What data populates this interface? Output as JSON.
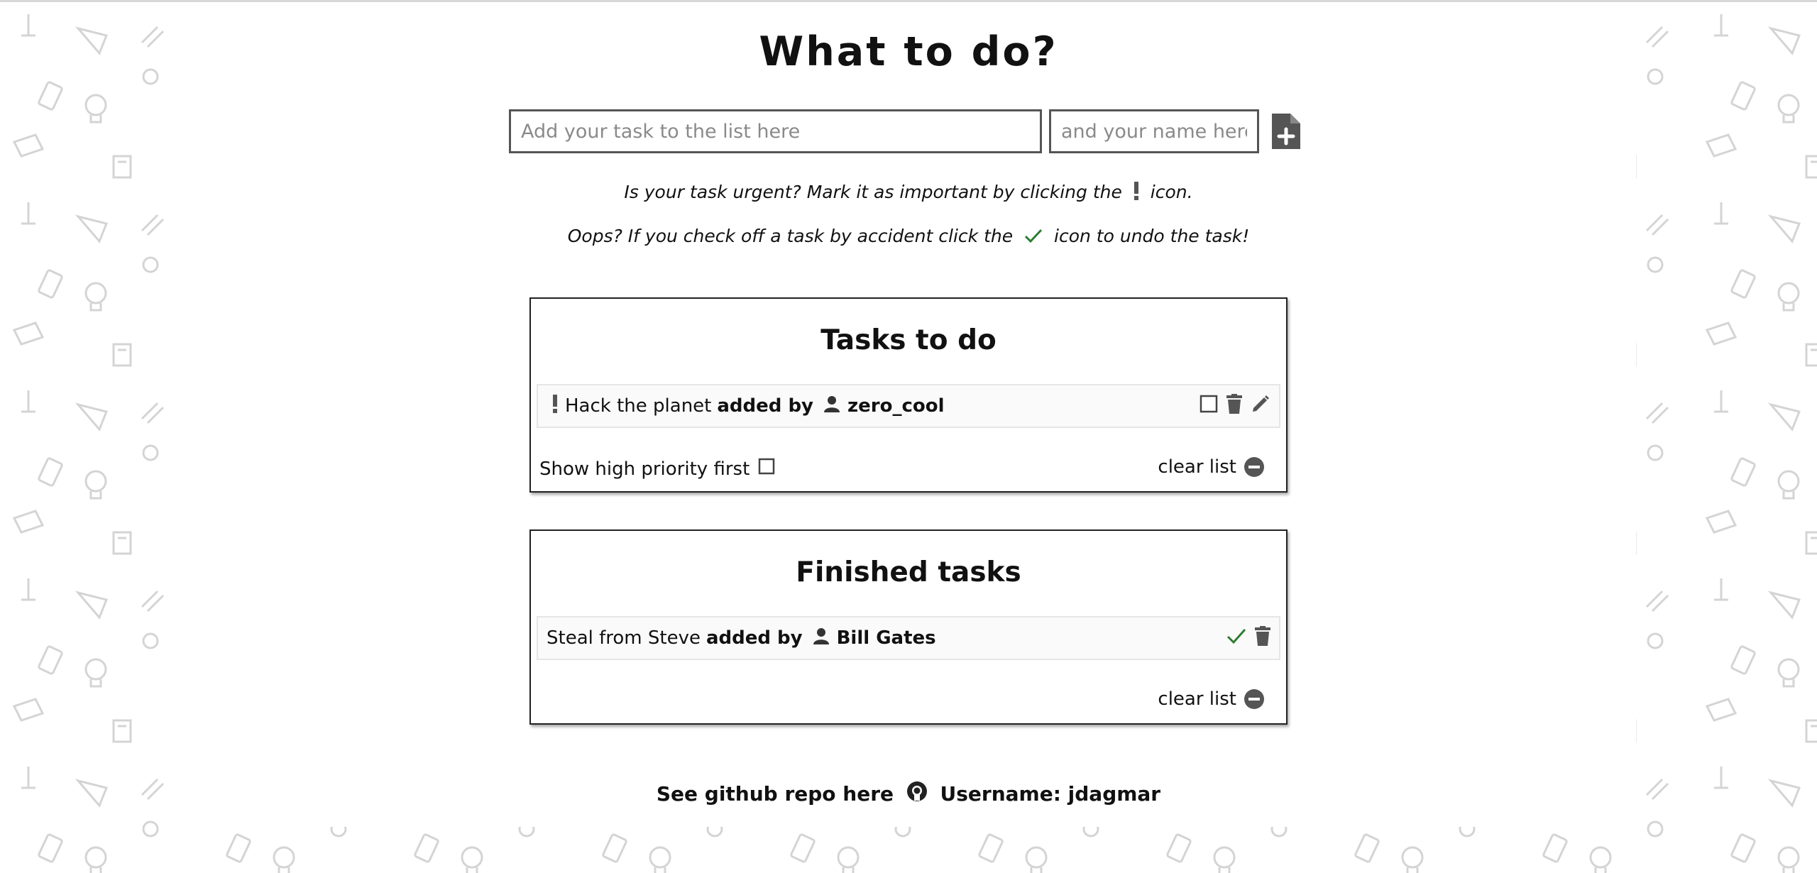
{
  "page": {
    "title": "What to do?"
  },
  "inputs": {
    "task_placeholder": "Add your task to the list here",
    "name_placeholder": "and your name here"
  },
  "hints": {
    "urgent_before": "Is your task urgent? Mark it as important by clicking the",
    "urgent_after": "icon.",
    "oops_before": "Oops? If you check off a task by accident click the",
    "oops_after": "icon to undo the task!"
  },
  "todo": {
    "heading": "Tasks to do",
    "tasks": [
      {
        "text": "Hack the planet",
        "added_by_label": "added by",
        "user": "zero_cool",
        "important": true
      }
    ],
    "priority_toggle_label": "Show high priority first",
    "clear_label": "clear list"
  },
  "finished": {
    "heading": "Finished tasks",
    "tasks": [
      {
        "text": "Steal from Steve",
        "added_by_label": "added by",
        "user": "Bill Gates"
      }
    ],
    "clear_label": "clear list"
  },
  "footer": {
    "repo_text": "See github repo here",
    "username_text": "Username: jdagmar"
  },
  "icons": {
    "add": "add-file-icon",
    "important": "exclamation-icon",
    "check": "check-icon",
    "checkbox": "checkbox-icon",
    "trash": "trash-icon",
    "edit": "pencil-icon",
    "user": "user-icon",
    "clear": "minus-circle-icon",
    "github": "github-icon"
  },
  "colors": {
    "check_green": "#2e7d32",
    "icon_gray": "#555555",
    "border": "#222222"
  }
}
